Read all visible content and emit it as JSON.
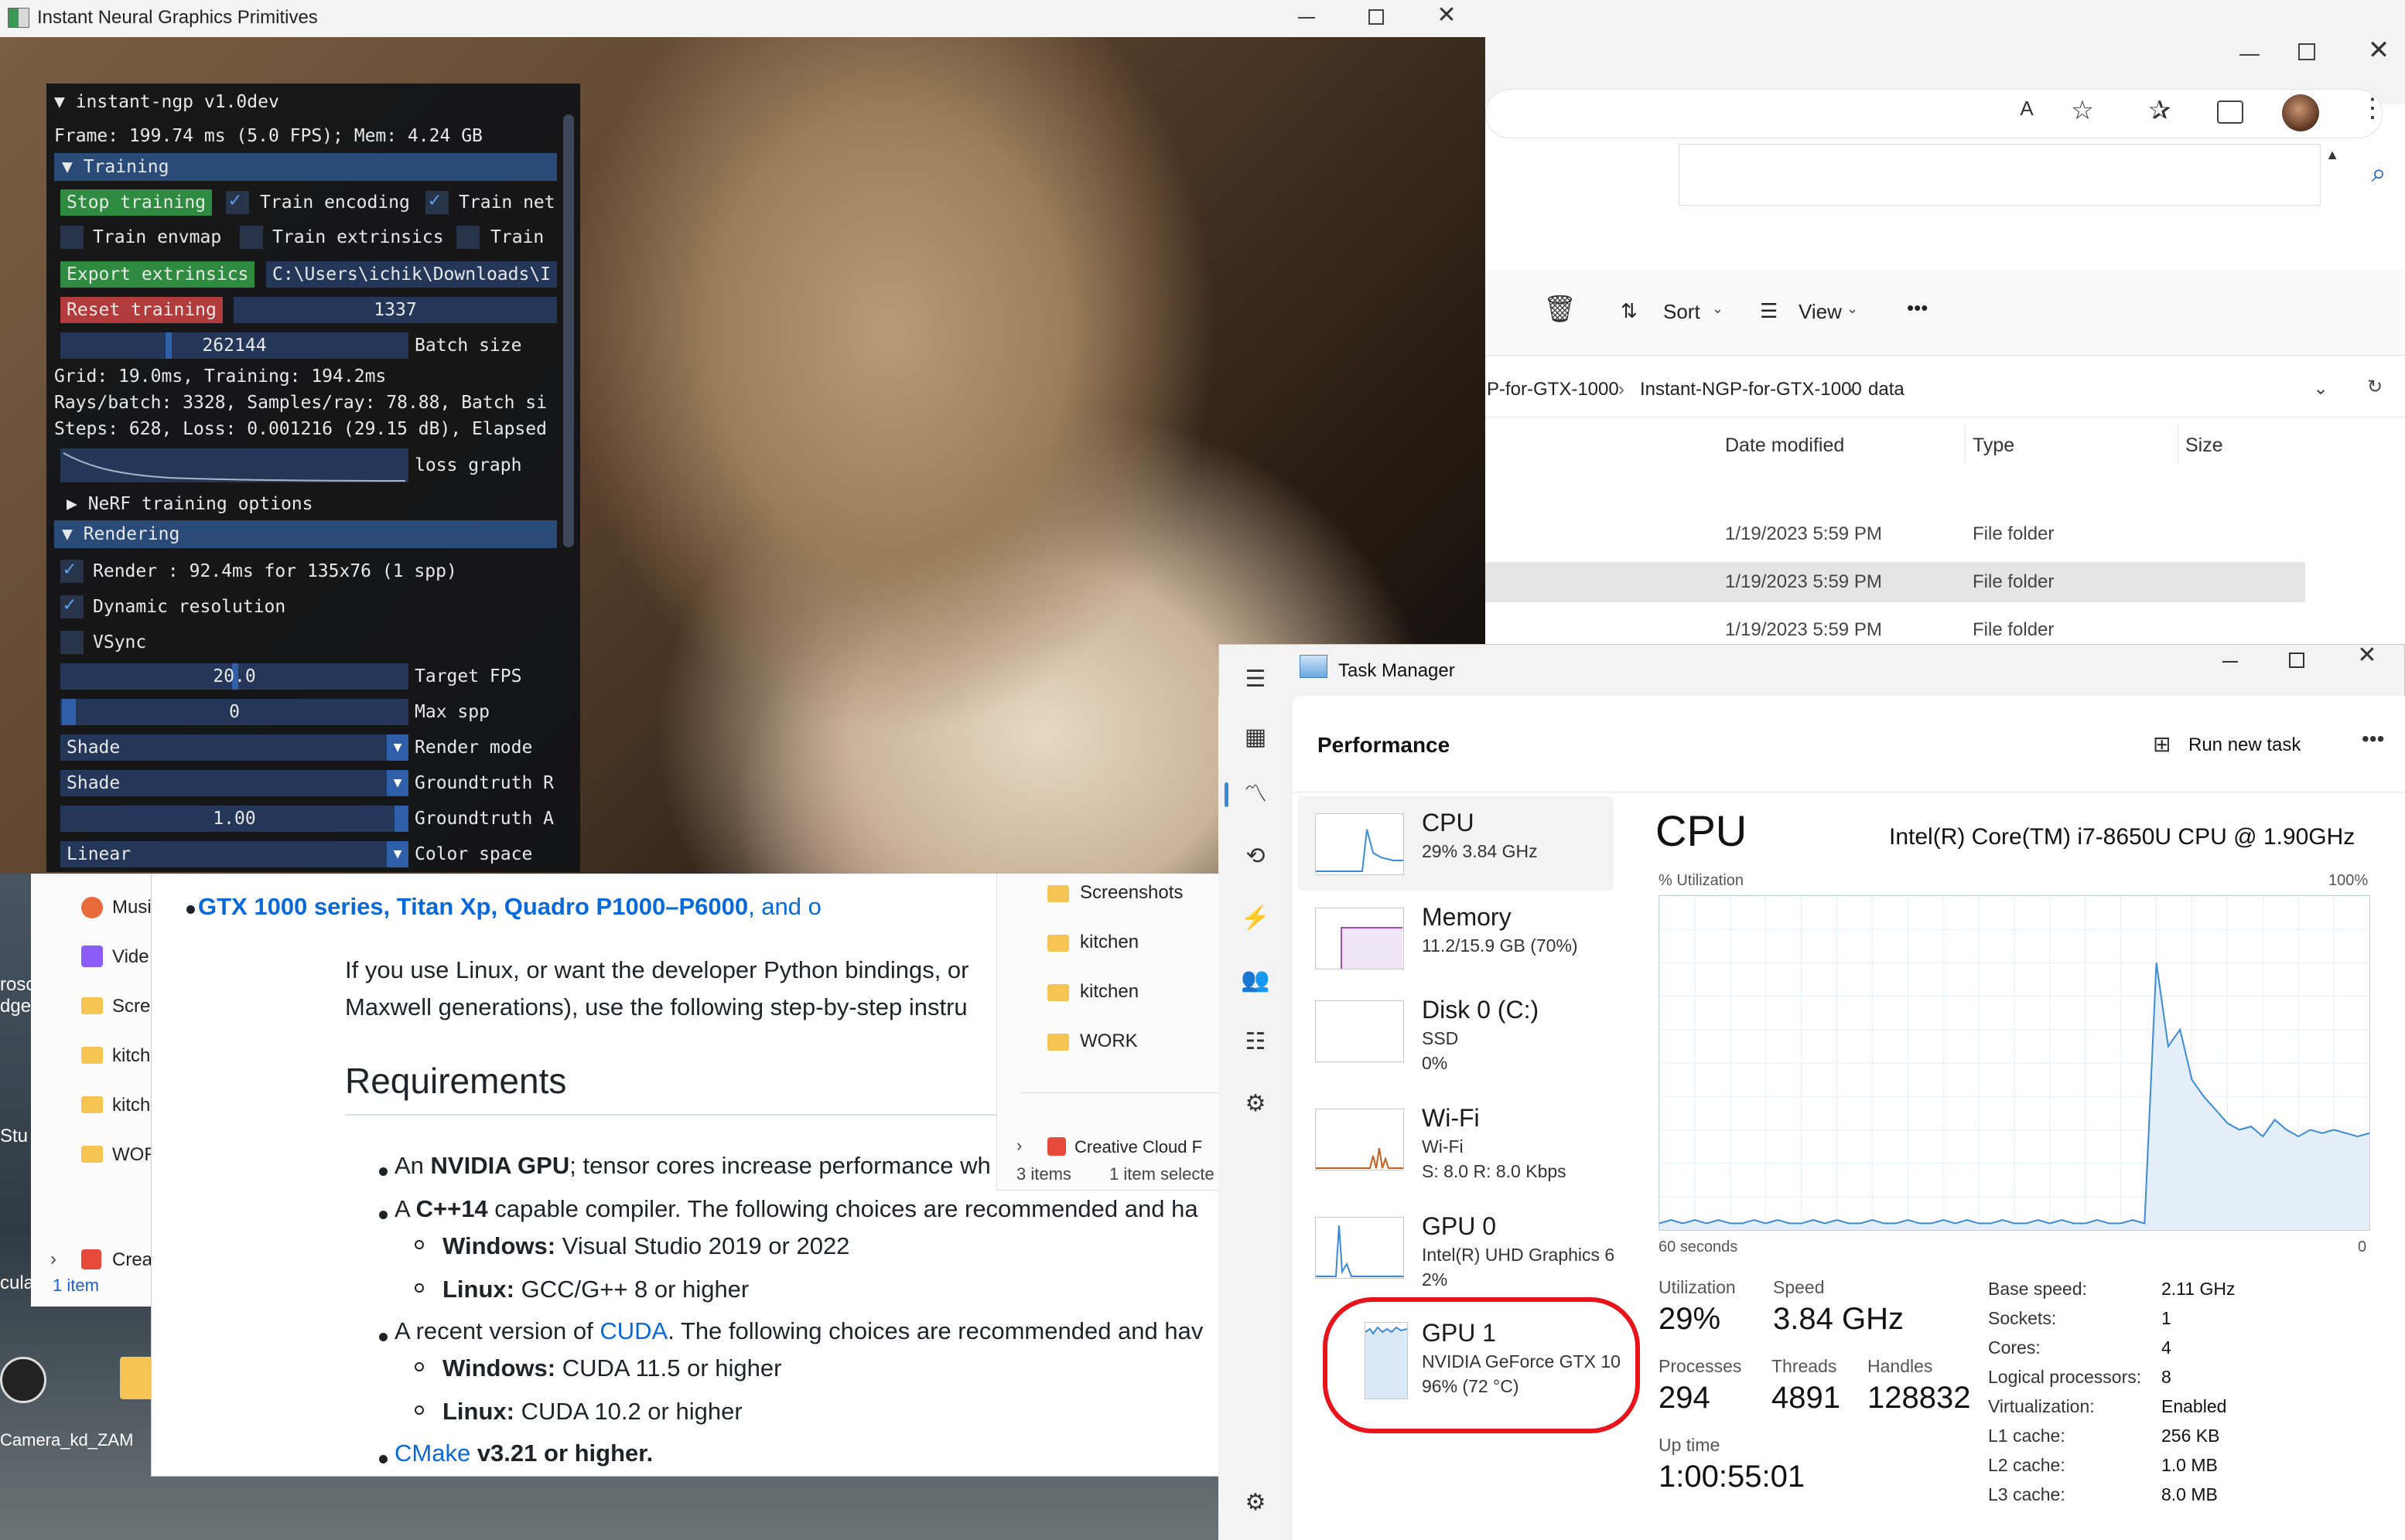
{
  "ngp": {
    "window_title": "Instant Neural Graphics Primitives",
    "gui_title": "instant-ngp v1.0dev",
    "frame_stats": "Frame: 199.74 ms (5.0 FPS); Mem: 4.24 GB",
    "training_header": "Training",
    "stop_training": "Stop training",
    "train_encoding": "Train encoding",
    "train_net": "Train net",
    "train_envmap": "Train envmap",
    "train_extrinsics": "Train extrinsics",
    "train": "Train",
    "export_extrinsics": "Export extrinsics",
    "export_path": "C:\\Users\\ichik\\Downloads\\I",
    "reset_training": "Reset training",
    "seed": "1337",
    "batch_value": "262144",
    "batch_label": "Batch size",
    "timing": "Grid: 19.0ms, Training: 194.2ms",
    "rays": "Rays/batch: 3328, Samples/ray: 78.88, Batch si",
    "steps": "Steps: 628, Loss: 0.001216 (29.15 dB), Elapsed",
    "loss_graph": "loss graph",
    "nerf_options": "NeRF training options",
    "rendering_header": "Rendering",
    "render_line": "Render : 92.4ms for 135x76 (1 spp)",
    "dynamic_resolution": "Dynamic resolution",
    "vsync": "VSync",
    "target_fps_value": "20.0",
    "target_fps_label": "Target FPS",
    "max_spp_value": "0",
    "max_spp_label": "Max spp",
    "render_mode_value": "Shade",
    "render_mode_label": "Render mode",
    "groundtruth_r_value": "Shade",
    "groundtruth_r_label": "Groundtruth R",
    "groundtruth_a_value": "1.00",
    "groundtruth_a_label": "Groundtruth A",
    "color_space_value": "Linear",
    "color_space_label": "Color space"
  },
  "explorer": {
    "breadcrumb": [
      "P-for-GTX-1000",
      "Instant-NGP-for-GTX-1000",
      "data"
    ],
    "sort_label": "Sort",
    "view_label": "View",
    "columns": [
      "Date modified",
      "Type",
      "Size"
    ],
    "rows": [
      {
        "date": "1/19/2023 5:59 PM",
        "type": "File folder"
      },
      {
        "date": "1/19/2023 5:59 PM",
        "type": "File folder"
      },
      {
        "date": "1/19/2023 5:59 PM",
        "type": "File folder"
      }
    ]
  },
  "desktop": {
    "icons": [
      "Musi",
      "Vide",
      "Scree",
      "kitch",
      "kitch",
      "WOR",
      "Creat"
    ],
    "side_count": "1 item",
    "camera_label": "Camera_kd_ZAM",
    "left_labels": [
      "rosc",
      "dge",
      "Stu",
      "cula"
    ]
  },
  "filepopup": {
    "items": [
      "Screenshots",
      "kitchen",
      "kitchen",
      "WORK"
    ],
    "creative_cloud": "Creative Cloud F",
    "count": "3 items",
    "selected": "1 item selecte"
  },
  "doc": {
    "bullet_gtx_link": "GTX 1000 series, Titan Xp, Quadro P1000–P6000",
    "bullet_gtx_rest": ", and o",
    "para1": "If you use Linux, or want the developer Python bindings, or",
    "para2": "Maxwell generations), use the following step-by-step instru",
    "requirements": "Requirements",
    "req1_pre": "An ",
    "req1_bold": "NVIDIA GPU",
    "req1_rest": "; tensor cores increase performance wh",
    "req2_pre": "A ",
    "req2_bold": "C++14",
    "req2_rest": " capable compiler. The following choices are recommended and ha",
    "req2_win_b": "Windows:",
    "req2_win": " Visual Studio 2019 or 2022",
    "req2_lin_b": "Linux:",
    "req2_lin": " GCC/G++ 8 or higher",
    "req3_pre": "A recent version of ",
    "req3_link": "CUDA",
    "req3_rest": ". The following choices are recommended and hav",
    "req3_win_b": "Windows:",
    "req3_win": " CUDA 11.5 or higher",
    "req3_lin_b": "Linux:",
    "req3_lin": " CUDA 10.2 or higher",
    "req4_link": "CMake",
    "req4_rest": " v3.21 or higher."
  },
  "taskmanager": {
    "title": "Task Manager",
    "section": "Performance",
    "run_new_task": "Run new task",
    "resources": [
      {
        "name": "CPU",
        "sub1": "29% 3.84 GHz",
        "sub2": ""
      },
      {
        "name": "Memory",
        "sub1": "11.2/15.9 GB (70%)",
        "sub2": ""
      },
      {
        "name": "Disk 0 (C:)",
        "sub1": "SSD",
        "sub2": "0%"
      },
      {
        "name": "Wi-Fi",
        "sub1": "Wi-Fi",
        "sub2": "S: 8.0 R: 8.0 Kbps"
      },
      {
        "name": "GPU 0",
        "sub1": "Intel(R) UHD Graphics 6",
        "sub2": "2%"
      },
      {
        "name": "GPU 1",
        "sub1": "NVIDIA GeForce GTX 10",
        "sub2": "96% (72 °C)"
      }
    ],
    "cpu_title": "CPU",
    "cpu_model": "Intel(R) Core(TM) i7-8650U CPU @ 1.90GHz",
    "util_axis": "% Utilization",
    "util_max": "100%",
    "time_axis": "60 seconds",
    "time_min": "0",
    "stats": {
      "utilization_label": "Utilization",
      "utilization": "29%",
      "speed_label": "Speed",
      "speed": "3.84 GHz",
      "processes_label": "Processes",
      "processes": "294",
      "threads_label": "Threads",
      "threads": "4891",
      "handles_label": "Handles",
      "handles": "128832",
      "uptime_label": "Up time",
      "uptime": "1:00:55:01"
    },
    "specs": [
      {
        "k": "Base speed:",
        "v": "2.11 GHz"
      },
      {
        "k": "Sockets:",
        "v": "1"
      },
      {
        "k": "Cores:",
        "v": "4"
      },
      {
        "k": "Logical processors:",
        "v": "8"
      },
      {
        "k": "Virtualization:",
        "v": "Enabled"
      },
      {
        "k": "L1 cache:",
        "v": "256 KB"
      },
      {
        "k": "L2 cache:",
        "v": "1.0 MB"
      },
      {
        "k": "L3 cache:",
        "v": "8.0 MB"
      }
    ],
    "cpu_history": [
      2,
      3,
      2,
      3,
      2,
      3,
      2,
      2,
      3,
      2,
      3,
      2,
      2,
      3,
      2,
      3,
      2,
      2,
      3,
      2,
      2,
      3,
      2,
      2,
      3,
      2,
      3,
      2,
      2,
      3,
      2,
      2,
      3,
      2,
      3,
      2,
      2,
      3,
      2,
      2,
      3,
      2,
      80,
      55,
      60,
      45,
      40,
      36,
      32,
      30,
      31,
      28,
      33,
      30,
      28,
      30,
      29,
      30,
      29,
      28,
      29
    ],
    "accent": "#3b8ad9",
    "highlight": "#e8131b"
  }
}
